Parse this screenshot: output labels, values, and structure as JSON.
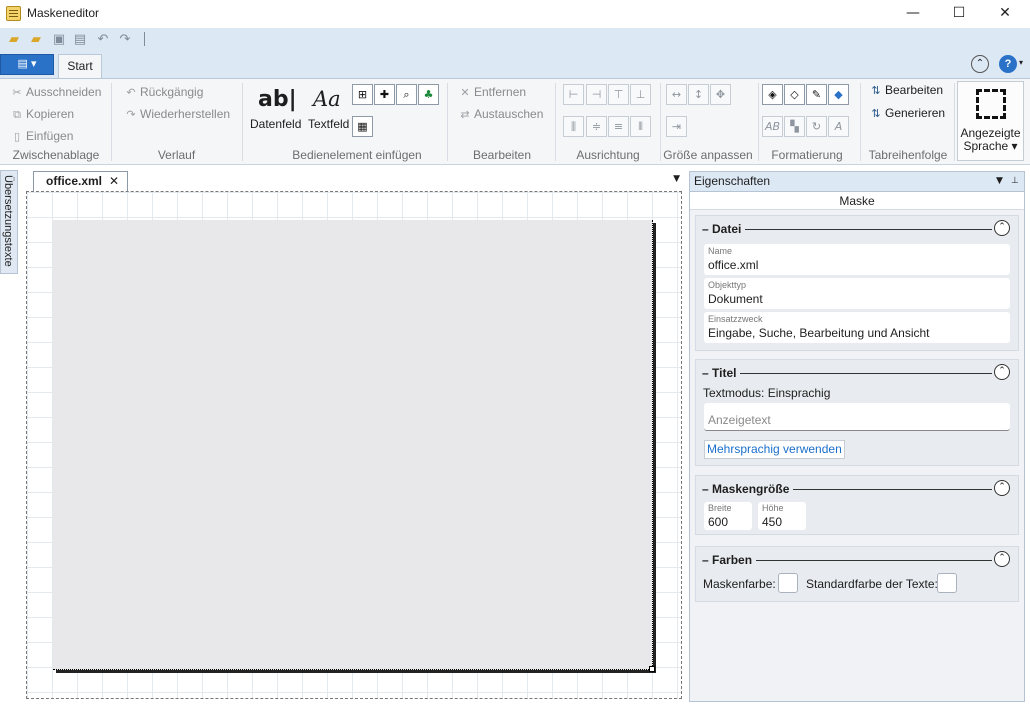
{
  "window": {
    "title": "Maskeneditor",
    "controls": {
      "minimize": "—",
      "maximize": "☐",
      "close": "✕"
    }
  },
  "quick_access": [
    "open-folder-icon",
    "open-icon",
    "save-icon",
    "save-all-icon",
    "undo-icon",
    "redo-icon"
  ],
  "ribbon": {
    "tabs": [
      {
        "label": "Start",
        "active": true
      }
    ],
    "groups": {
      "zwischenablage": {
        "label": "Zwischenablage",
        "ausschneiden": "Ausschneiden",
        "kopieren": "Kopieren",
        "einfuegen": "Einfügen"
      },
      "verlauf": {
        "label": "Verlauf",
        "rueckgaengig": "Rückgängig",
        "wiederherstellen": "Wiederherstellen"
      },
      "bedienelement": {
        "label": "Bedienelement einfügen",
        "datenfeld": "Datenfeld",
        "datenfeld_glyph": "ab|",
        "textfeld": "Textfeld",
        "textfeld_glyph": "Aa"
      },
      "bearbeiten": {
        "label": "Bearbeiten",
        "entfernen": "Entfernen",
        "austauschen": "Austauschen"
      },
      "ausrichtung": {
        "label": "Ausrichtung"
      },
      "groesse": {
        "label": "Größe anpassen"
      },
      "formatierung": {
        "label": "Formatierung"
      },
      "tabreihenfolge": {
        "label": "Tabreihenfolge",
        "bearbeiten": "Bearbeiten",
        "generieren": "Generieren"
      },
      "sprache": {
        "line1": "Angezeigte",
        "line2": "Sprache ▾"
      }
    }
  },
  "left_panel_tab": "Übersetzungstexte",
  "document": {
    "tab_label": "office.xml",
    "close": "✕"
  },
  "properties": {
    "header": "Eigenschaften",
    "object": "Maske",
    "datei": {
      "title": "Datei",
      "name_label": "Name",
      "name_value": "office.xml",
      "objekttyp_label": "Objekttyp",
      "objekttyp_value": "Dokument",
      "einsatzzweck_label": "Einsatzzweck",
      "einsatzzweck_value": "Eingabe, Suche, Bearbeitung und Ansicht"
    },
    "titel": {
      "title": "Titel",
      "textmodus": "Textmodus: Einsprachig",
      "anzeigetext_placeholder": "Anzeigetext",
      "mehrsprachig": "Mehrsprachig verwenden"
    },
    "maskengroesse": {
      "title": "Maskengröße",
      "breite_label": "Breite",
      "breite_value": "600",
      "hoehe_label": "Höhe",
      "hoehe_value": "450"
    },
    "farben": {
      "title": "Farben",
      "maskenfarbe": "Maskenfarbe:",
      "standardfarbe": "Standardfarbe der Texte:"
    }
  },
  "colors": {
    "accent": "#2a72c8",
    "ribbon_bg": "#f5f6f7",
    "mask_bg": "#e8e8ea"
  }
}
